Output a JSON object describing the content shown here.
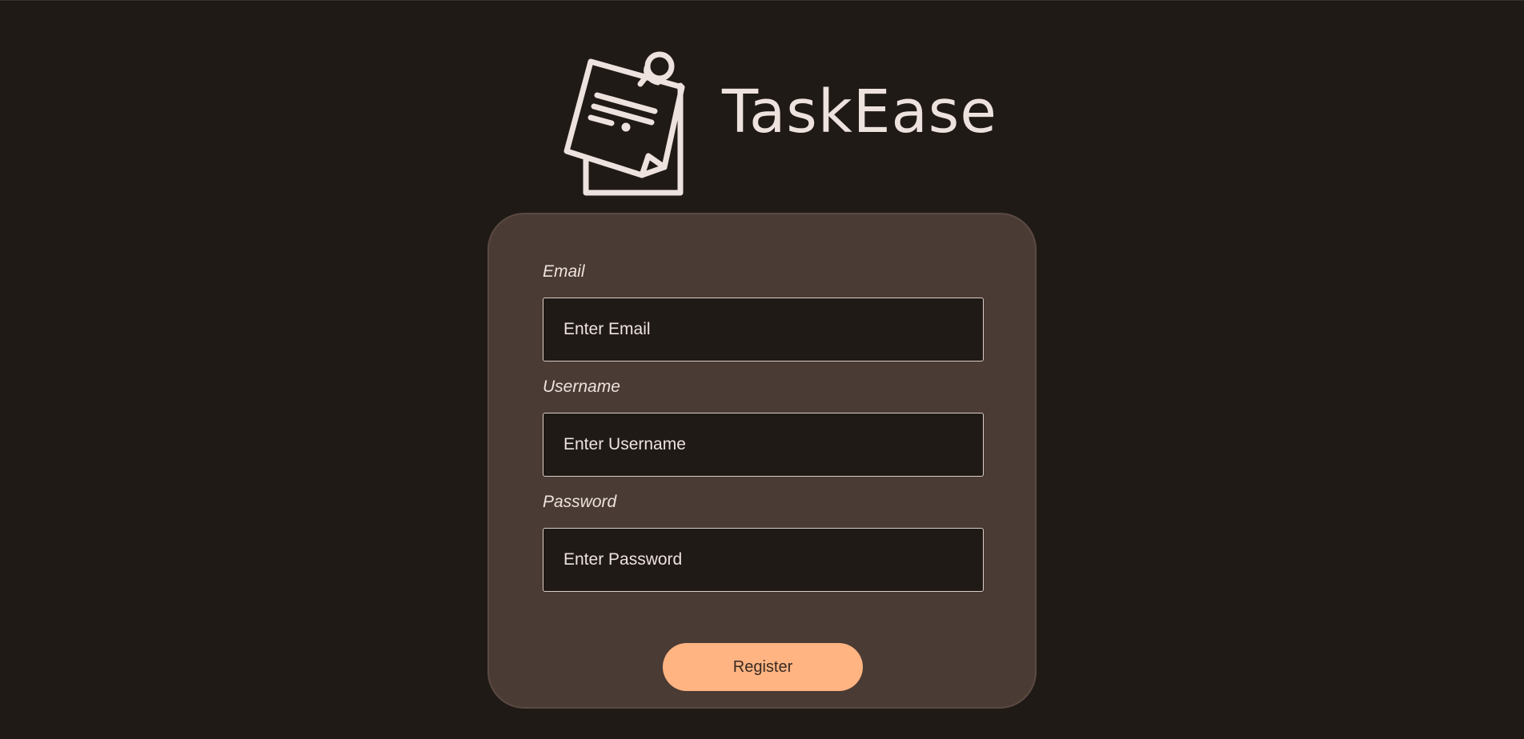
{
  "app": {
    "name": "TaskEase",
    "logo_icon": "sticky-note-pin-icon"
  },
  "form": {
    "email": {
      "label": "Email",
      "placeholder": "Enter Email",
      "value": ""
    },
    "username": {
      "label": "Username",
      "placeholder": "Enter Username",
      "value": ""
    },
    "password": {
      "label": "Password",
      "placeholder": "Enter Password",
      "value": ""
    },
    "submit_label": "Register"
  },
  "colors": {
    "background": "#201a17",
    "card": "#4a3b34",
    "text": "#ede2dd",
    "accent": "#ffb482"
  }
}
